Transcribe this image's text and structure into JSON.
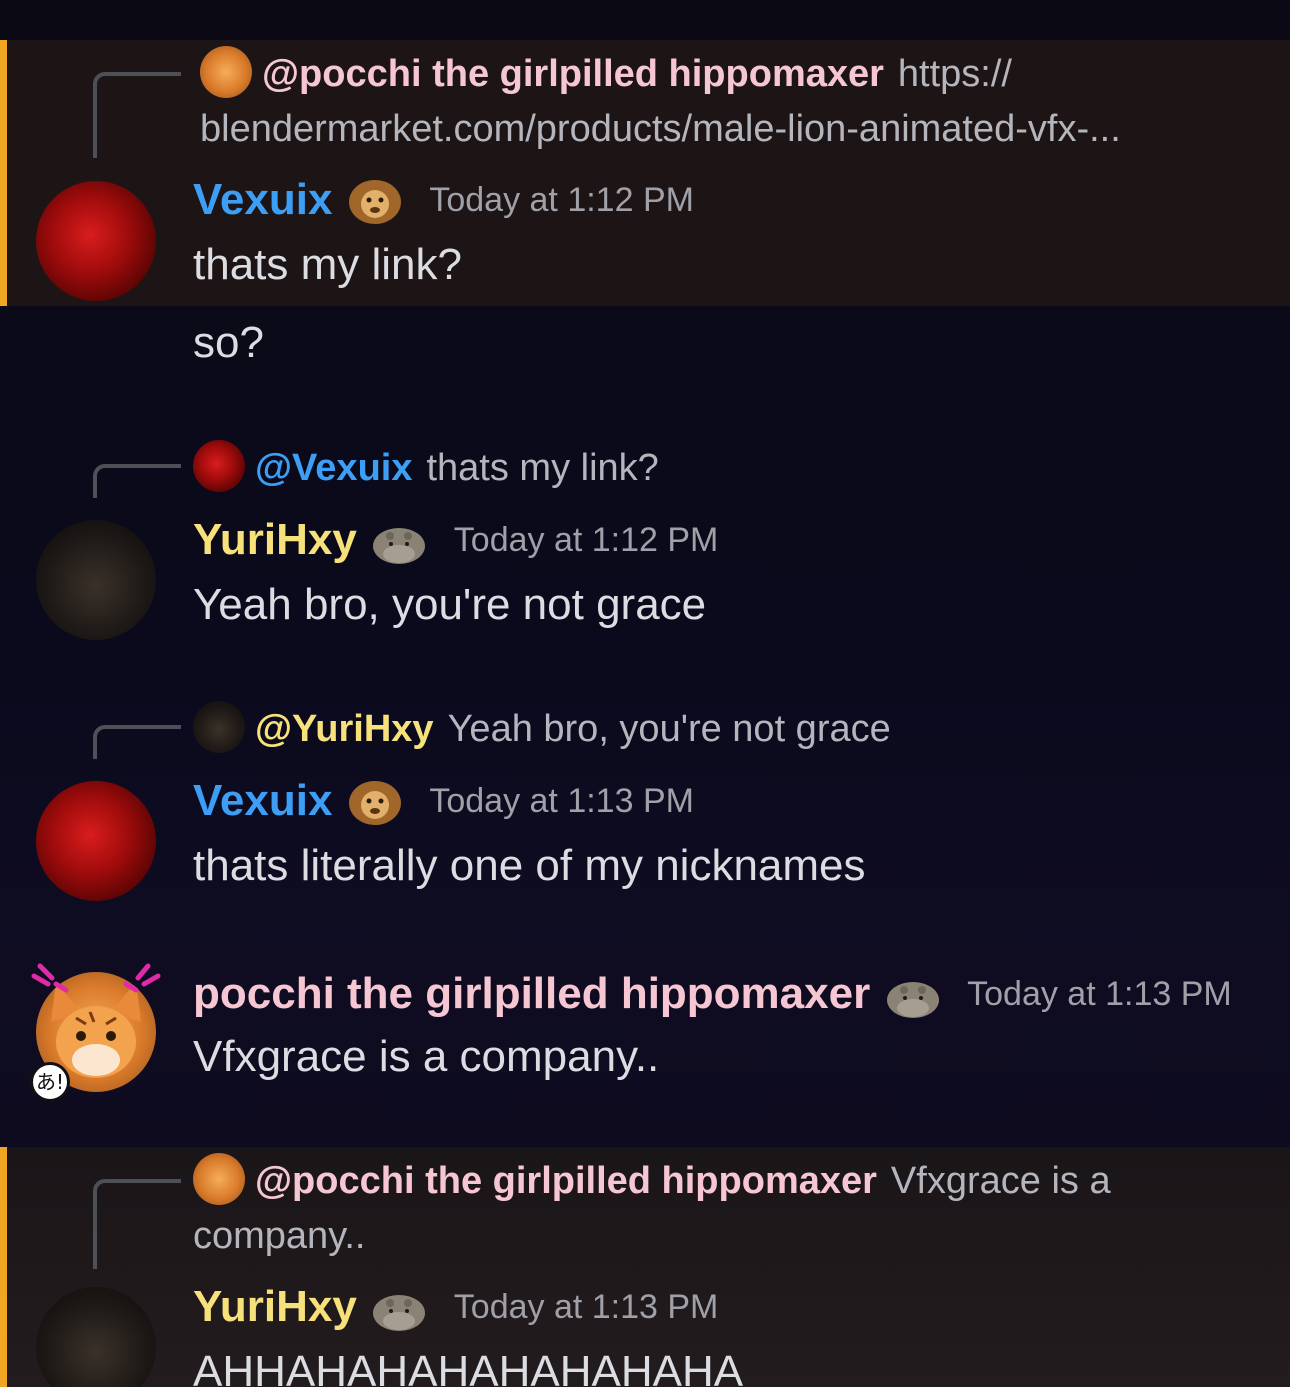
{
  "messages": [
    {
      "reply": {
        "name": "@pocchi the girlpilled hippomaxer",
        "text": "https:// blendermarket.com/products/male-lion-animated-vfx-..."
      },
      "author": "Vexuix",
      "time": "Today at 1:12 PM",
      "text": "thats my link?",
      "followup": "so?"
    },
    {
      "reply": {
        "name": "@Vexuix",
        "text": "thats my link?"
      },
      "author": "YuriHxy",
      "time": "Today at 1:12 PM",
      "text": "Yeah bro, you're not grace"
    },
    {
      "reply": {
        "name": "@YuriHxy",
        "text": "Yeah bro, you're not grace"
      },
      "author": "Vexuix",
      "time": "Today at 1:13 PM",
      "text": "thats literally one of my nicknames"
    },
    {
      "author": "pocchi the girlpilled hippomaxer",
      "time": "Today at 1:13 PM",
      "text": "Vfxgrace is a company.."
    },
    {
      "reply": {
        "name": "@pocchi the girlpilled hippomaxer",
        "text": "Vfxgrace is a company.."
      },
      "author": "YuriHxy",
      "time": "Today at 1:13 PM",
      "text": "AHHAHAHAHAHAHAHAHA"
    }
  ],
  "icons": {
    "lion": "lion-emoji-icon",
    "hippo": "hippo-emoji-icon",
    "nametag": "あ!"
  },
  "colors": {
    "vexuix": "#3d9ef5",
    "yurihxy": "#f7e17a",
    "pocchi": "#f6c7d2",
    "highlight_bar": "#f0a623"
  }
}
